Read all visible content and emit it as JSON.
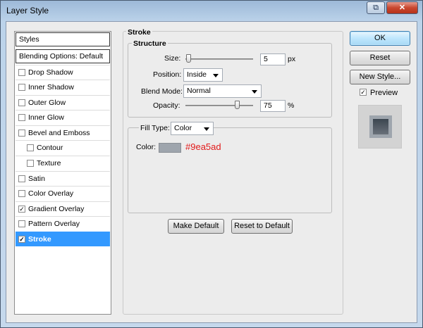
{
  "window": {
    "title": "Layer Style"
  },
  "titlebar": {
    "help_icon": "⧉",
    "close_icon": "✕"
  },
  "styles_panel": {
    "header": "Styles",
    "blending": "Blending Options: Default",
    "items": [
      {
        "label": "Drop Shadow",
        "checked": false
      },
      {
        "label": "Inner Shadow",
        "checked": false
      },
      {
        "label": "Outer Glow",
        "checked": false
      },
      {
        "label": "Inner Glow",
        "checked": false
      },
      {
        "label": "Bevel and Emboss",
        "checked": false
      },
      {
        "label": "Contour",
        "checked": false
      },
      {
        "label": "Texture",
        "checked": false
      },
      {
        "label": "Satin",
        "checked": false
      },
      {
        "label": "Color Overlay",
        "checked": false
      },
      {
        "label": "Gradient Overlay",
        "checked": true
      },
      {
        "label": "Pattern Overlay",
        "checked": false
      },
      {
        "label": "Stroke",
        "checked": true,
        "selected": true
      }
    ]
  },
  "stroke": {
    "title": "Stroke",
    "structure_title": "Structure",
    "size_label": "Size:",
    "size_value": "5",
    "size_unit": "px",
    "position_label": "Position:",
    "position_value": "Inside",
    "blend_label": "Blend Mode:",
    "blend_value": "Normal",
    "opacity_label": "Opacity:",
    "opacity_value": "75",
    "opacity_unit": "%",
    "fill_type_label": "Fill Type:",
    "fill_type_value": "Color",
    "color_label": "Color:",
    "color_hex": "#9ea5ad",
    "make_default": "Make Default",
    "reset_default": "Reset to Default"
  },
  "actions": {
    "ok": "OK",
    "reset": "Reset",
    "new_style": "New Style...",
    "preview_label": "Preview",
    "preview_checked": true
  }
}
